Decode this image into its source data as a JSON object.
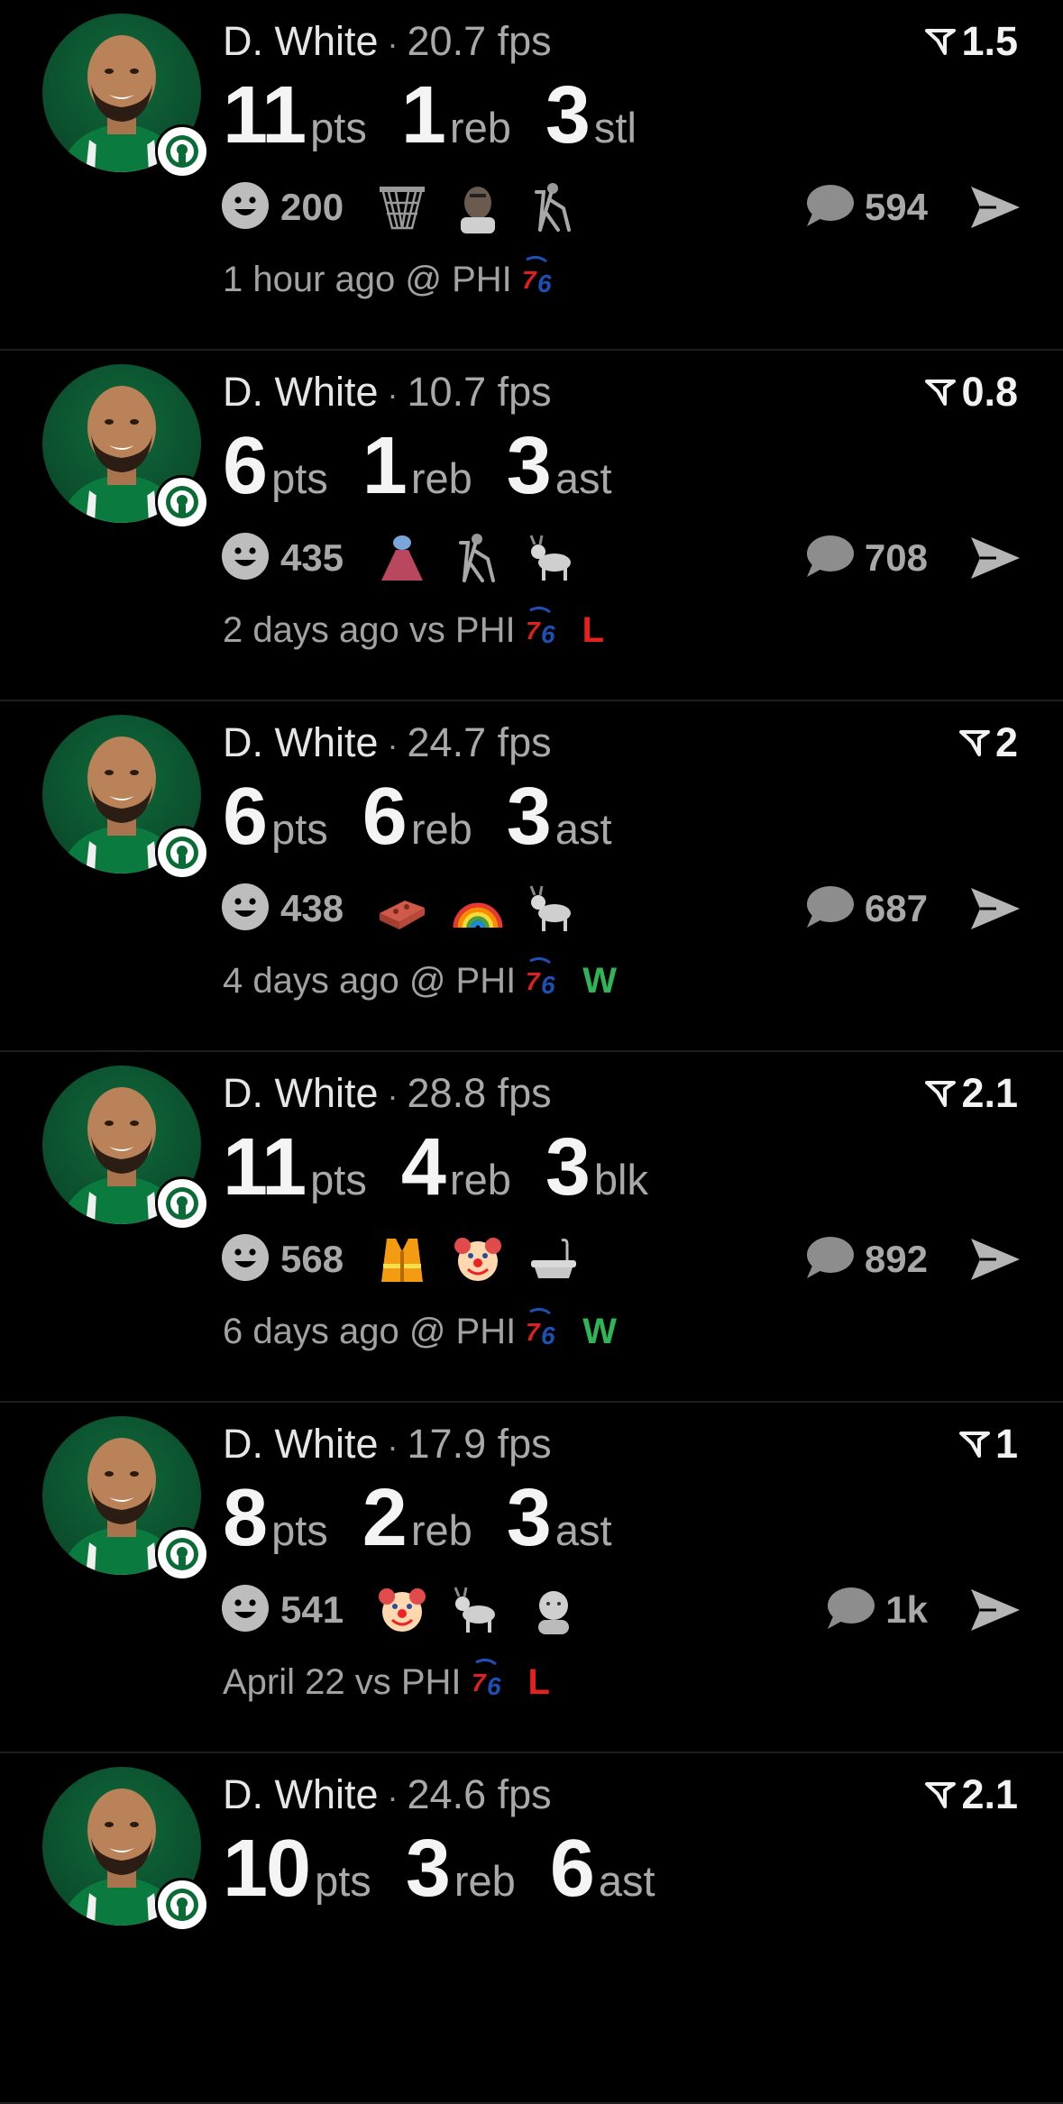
{
  "colors": {
    "background": "#000000",
    "win": "#2fb457",
    "loss": "#e3221d",
    "celtics_green": "#0b4d2c",
    "muted_text": "#a2a2a2"
  },
  "icons": {
    "reaction": "smiley-face-icon",
    "comment": "speech-bubble-icon",
    "share": "paper-plane-icon",
    "rating": "bookmark-flag-icon",
    "opponent": "sixers-76-logo",
    "team": "celtics-logo"
  },
  "posts": [
    {
      "player": "D. White",
      "fps": "20.7 fps",
      "rating": "1.5",
      "stats": [
        {
          "num": "11",
          "unit": "pts"
        },
        {
          "num": "1",
          "unit": "reb"
        },
        {
          "num": "3",
          "unit": "stl"
        }
      ],
      "reactions": "200",
      "emojis": [
        "hoop-net-icon",
        "player-face-icon",
        "crutch-walker-icon"
      ],
      "comments": "594",
      "meta": "1 hour ago @ PHI",
      "result": ""
    },
    {
      "player": "D. White",
      "fps": "10.7 fps",
      "rating": "0.8",
      "stats": [
        {
          "num": "6",
          "unit": "pts"
        },
        {
          "num": "1",
          "unit": "reb"
        },
        {
          "num": "3",
          "unit": "ast"
        }
      ],
      "reactions": "435",
      "emojis": [
        "volcano-icon",
        "crutch-walker-icon",
        "goat-icon"
      ],
      "comments": "708",
      "meta": "2 days ago vs PHI",
      "result": "L"
    },
    {
      "player": "D. White",
      "fps": "24.7 fps",
      "rating": "2",
      "stats": [
        {
          "num": "6",
          "unit": "pts"
        },
        {
          "num": "6",
          "unit": "reb"
        },
        {
          "num": "3",
          "unit": "ast"
        }
      ],
      "reactions": "438",
      "emojis": [
        "brick-icon",
        "rainbow-icon",
        "goat-icon"
      ],
      "comments": "687",
      "meta": "4 days ago @ PHI",
      "result": "W"
    },
    {
      "player": "D. White",
      "fps": "28.8 fps",
      "rating": "2.1",
      "stats": [
        {
          "num": "11",
          "unit": "pts"
        },
        {
          "num": "4",
          "unit": "reb"
        },
        {
          "num": "3",
          "unit": "blk"
        }
      ],
      "reactions": "568",
      "emojis": [
        "safety-vest-icon",
        "clown-face-icon",
        "bathtub-icon"
      ],
      "comments": "892",
      "meta": "6 days ago @ PHI",
      "result": "W"
    },
    {
      "player": "D. White",
      "fps": "17.9 fps",
      "rating": "1",
      "stats": [
        {
          "num": "8",
          "unit": "pts"
        },
        {
          "num": "2",
          "unit": "reb"
        },
        {
          "num": "3",
          "unit": "ast"
        }
      ],
      "reactions": "541",
      "emojis": [
        "clown-face-icon",
        "goat-icon",
        "baby-face-icon"
      ],
      "comments": "1k",
      "meta": "April 22 vs PHI",
      "result": "L"
    },
    {
      "player": "D. White",
      "fps": "24.6 fps",
      "rating": "2.1",
      "stats": [
        {
          "num": "10",
          "unit": "pts"
        },
        {
          "num": "3",
          "unit": "reb"
        },
        {
          "num": "6",
          "unit": "ast"
        }
      ],
      "reactions": "",
      "emojis": [],
      "comments": "",
      "meta": "",
      "result": ""
    }
  ]
}
